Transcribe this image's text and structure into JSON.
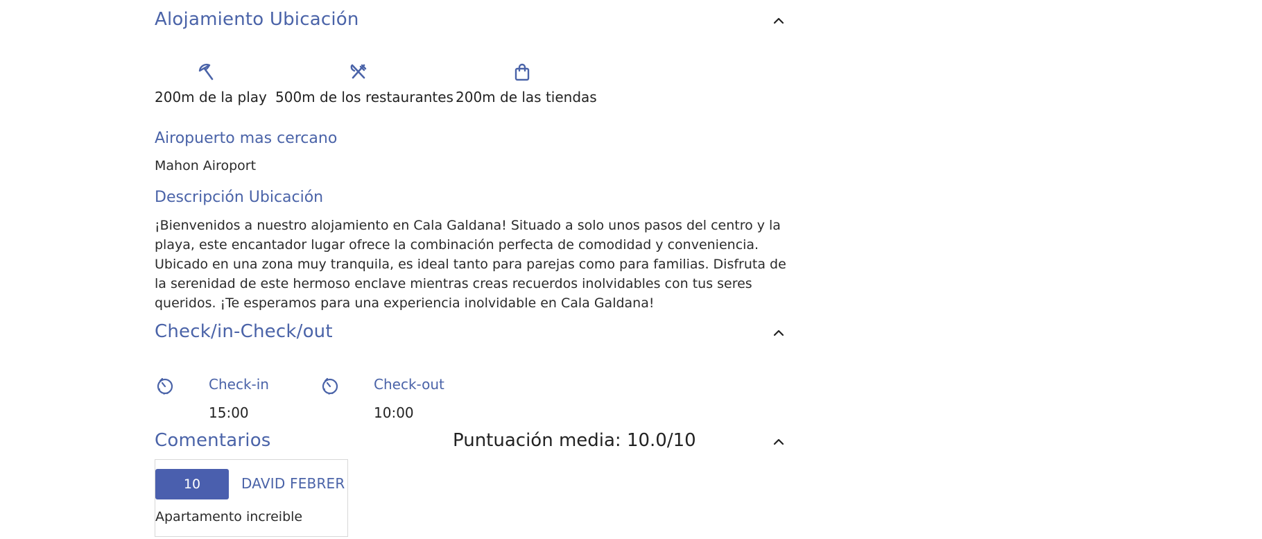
{
  "location_section": {
    "title": "Alojamiento Ubicación",
    "amenities": [
      {
        "icon": "beach-umbrella-icon",
        "label": "200m de la play"
      },
      {
        "icon": "utensils-icon",
        "label": "500m de los restaurantes"
      },
      {
        "icon": "shopping-bag-icon",
        "label": "200m de las tiendas"
      }
    ],
    "airport_heading": "Airopuerto mas cercano",
    "airport_value": "Mahon Airoport",
    "description_heading": "Descripción Ubicación",
    "description_text": "¡Bienvenidos a nuestro alojamiento en Cala Galdana! Situado a solo unos pasos del centro y la playa, este encantador lugar ofrece la combinación perfecta de comodidad y conveniencia. Ubicado en una zona muy tranquila, es ideal tanto para parejas como para familias. Disfruta de la serenidad de este hermoso enclave mientras creas recuerdos inolvidables con tus seres queridos. ¡Te esperamos para una experiencia inolvidable en Cala Galdana!"
  },
  "checkin_section": {
    "title": "Check/in-Check/out",
    "checkin_label": "Check-in",
    "checkin_time": "15:00",
    "checkout_label": "Check-out",
    "checkout_time": "10:00"
  },
  "comments_section": {
    "title": "Comentarios",
    "average_score": "Puntuación media: 10.0/10",
    "reviews": [
      {
        "rating": "10",
        "author": "DAVID FEBRER",
        "text": "Apartamento increible"
      }
    ]
  },
  "colors": {
    "accent": "#4a63a8",
    "rating_badge": "#4a5fae"
  }
}
